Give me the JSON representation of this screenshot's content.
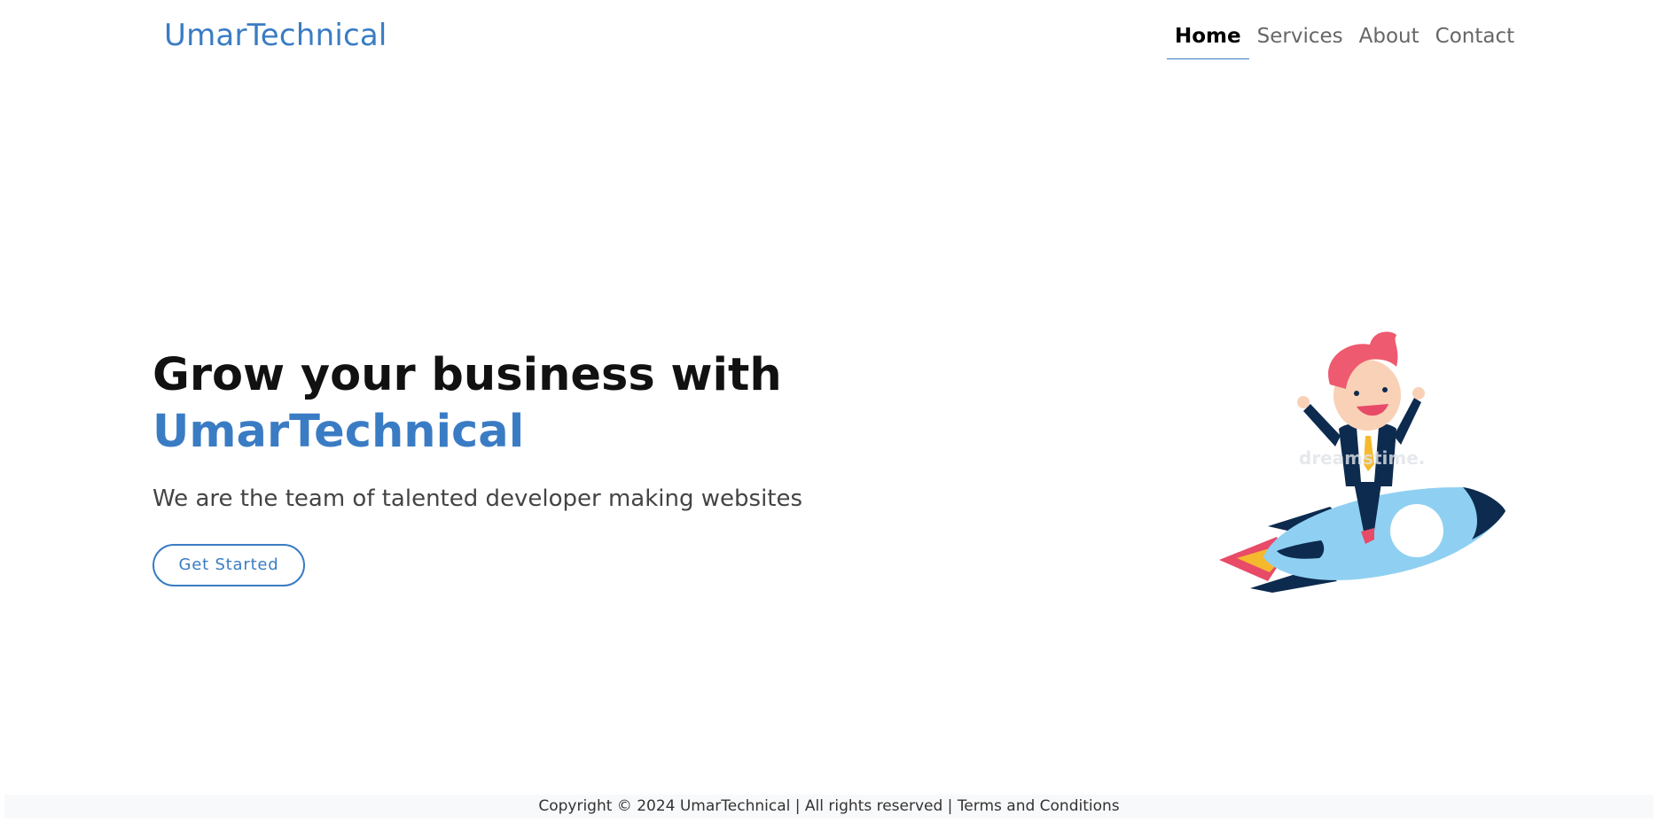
{
  "header": {
    "brand": "UmarTechnical",
    "nav": [
      {
        "label": "Home",
        "active": true
      },
      {
        "label": "Services",
        "active": false
      },
      {
        "label": "About",
        "active": false
      },
      {
        "label": "Contact",
        "active": false
      }
    ]
  },
  "hero": {
    "title_line1": "Grow your business with",
    "title_brand": "UmarTechnical",
    "subtitle": "We are the team of talented developer making websites",
    "cta_label": "Get Started",
    "illustration_watermark": "dreamstime."
  },
  "footer": {
    "copyright": "Copyright © 2024 UmarTechnical",
    "separator1": " | ",
    "rights": "All rights reserved",
    "separator2": " | ",
    "terms_link": "Terms and Conditions"
  },
  "colors": {
    "brand": "#3a7cc4",
    "heading": "#111111",
    "footer_bg": "#f8f9fa"
  }
}
